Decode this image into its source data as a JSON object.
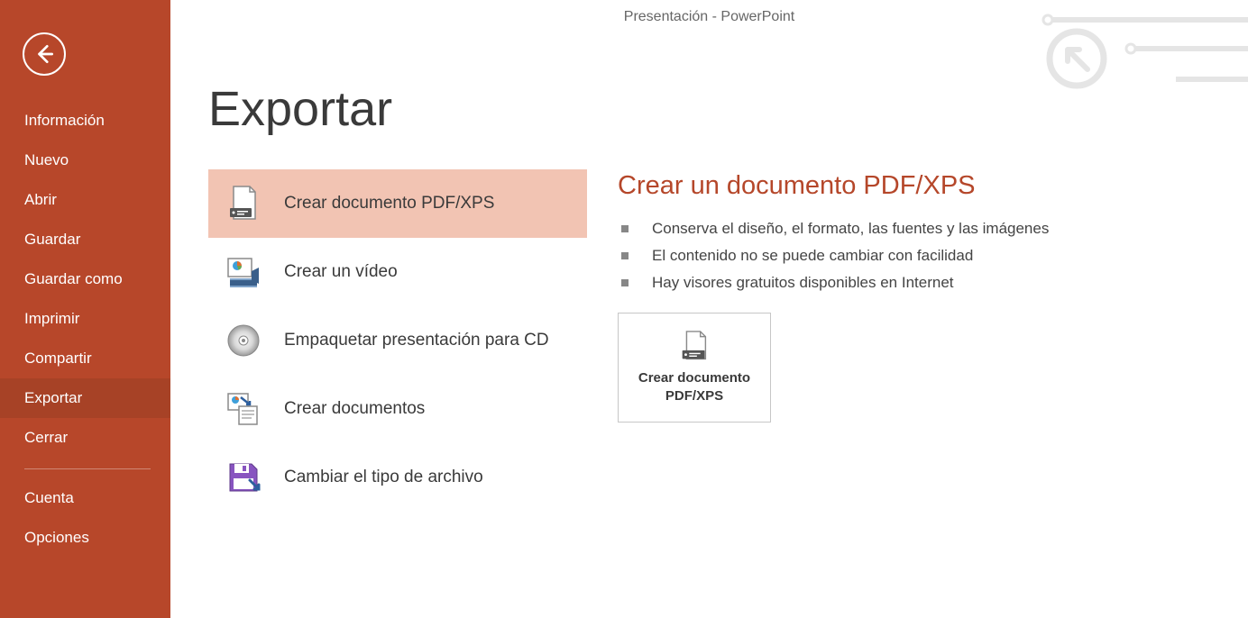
{
  "title_bar": "Presentación - PowerPoint",
  "page_title": "Exportar",
  "nav": {
    "informacion": "Información",
    "nuevo": "Nuevo",
    "abrir": "Abrir",
    "guardar": "Guardar",
    "guardar_como": "Guardar como",
    "imprimir": "Imprimir",
    "compartir": "Compartir",
    "exportar": "Exportar",
    "cerrar": "Cerrar",
    "cuenta": "Cuenta",
    "opciones": "Opciones"
  },
  "export_options": {
    "pdf": "Crear documento PDF/XPS",
    "video": "Crear un vídeo",
    "cd": "Empaquetar presentación para CD",
    "docs": "Crear documentos",
    "filetype": "Cambiar el tipo de archivo"
  },
  "detail": {
    "heading": "Crear un documento PDF/XPS",
    "bullets": [
      "Conserva el diseño, el formato, las fuentes y las imágenes",
      "El contenido no se puede cambiar con facilidad",
      "Hay visores gratuitos disponibles en Internet"
    ],
    "action_label": "Crear documento PDF/XPS"
  }
}
